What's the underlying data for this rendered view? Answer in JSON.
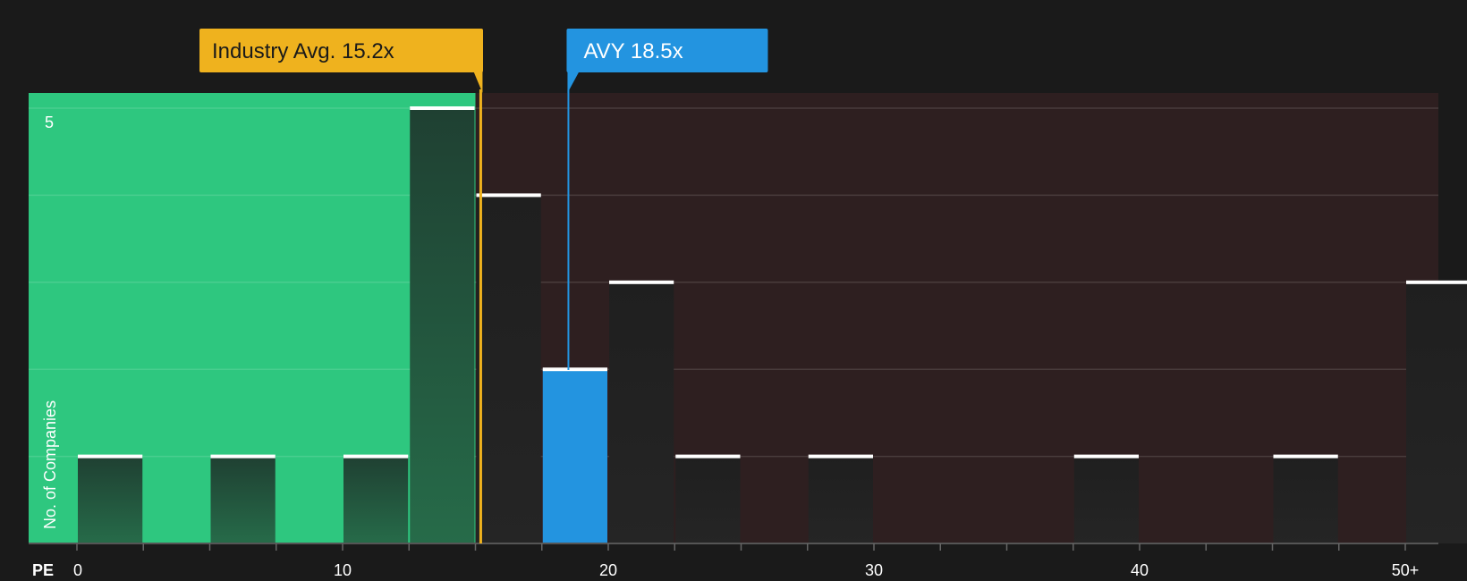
{
  "chart_data": {
    "type": "bar",
    "x_axis_prefix": "PE",
    "ylabel": "No. of Companies",
    "ylim": [
      0,
      5
    ],
    "y_ticks": [
      {
        "value": 5,
        "label": "5"
      }
    ],
    "x_ticks": [
      {
        "value": 0,
        "label": "0"
      },
      {
        "value": 10,
        "label": "10"
      },
      {
        "value": 20,
        "label": "20"
      },
      {
        "value": 30,
        "label": "30"
      },
      {
        "value": 40,
        "label": "40"
      },
      {
        "value": 50,
        "label": "50+"
      }
    ],
    "bins": [
      {
        "from": 0,
        "to": 2.5,
        "count": 1
      },
      {
        "from": 5,
        "to": 7.5,
        "count": 1
      },
      {
        "from": 10,
        "to": 12.5,
        "count": 1
      },
      {
        "from": 12.5,
        "to": 15,
        "count": 5
      },
      {
        "from": 15,
        "to": 17.5,
        "count": 4
      },
      {
        "from": 17.5,
        "to": 20,
        "count": 2,
        "highlight": true
      },
      {
        "from": 20,
        "to": 22.5,
        "count": 3
      },
      {
        "from": 22.5,
        "to": 25,
        "count": 1
      },
      {
        "from": 27.5,
        "to": 30,
        "count": 1
      },
      {
        "from": 37.5,
        "to": 40,
        "count": 1
      },
      {
        "from": 45,
        "to": 47.5,
        "count": 1
      },
      {
        "from": 50,
        "to": 52.5,
        "count": 3
      }
    ],
    "industry_avg": {
      "label": "Industry Avg. 15.2x",
      "value": 15.2
    },
    "company": {
      "label": "AVY 18.5x",
      "value": 18.5
    },
    "colors": {
      "background": "#1a1a1a",
      "undervalued_zone": "#2ec77f",
      "overvalued_zone": "#2e1f20",
      "bar": "#232323",
      "bar_highlight": "#2394e0",
      "bar_cap": "#ffffff",
      "industry": "#efb21e",
      "company": "#2394e0"
    }
  }
}
